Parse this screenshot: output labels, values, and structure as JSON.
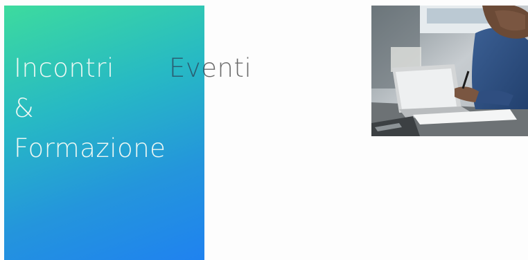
{
  "panel": {
    "title_lines": [
      "Incontri",
      "&",
      "Formazione"
    ],
    "eventi": "Eventi",
    "gradient_colors": [
      "#3ddb9e",
      "#27b9c4",
      "#2495dc",
      "#1f82f0"
    ]
  },
  "photo": {
    "icon": "person-writing-at-laptop-photo"
  }
}
